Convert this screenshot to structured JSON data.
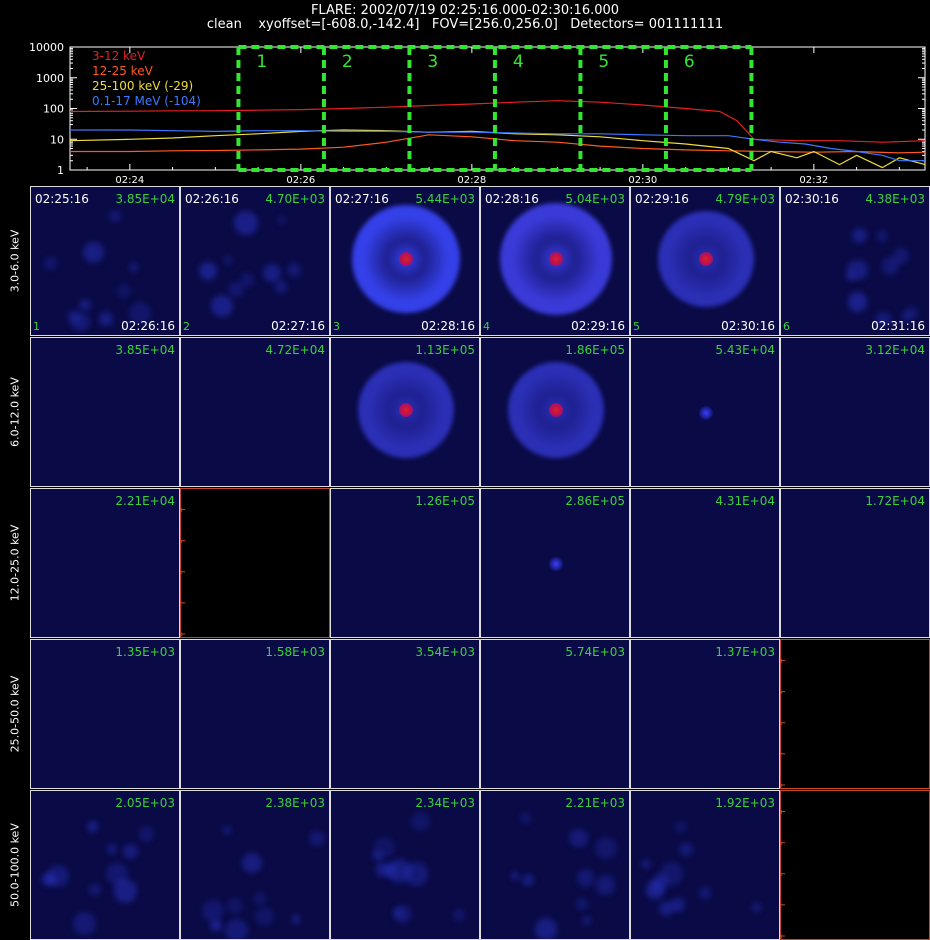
{
  "header": {
    "line1": "FLARE: 2002/07/19 02:25:16.000-02:30:16.000",
    "line2": "clean    xyoffset=[-608.0,-142.4]   FOV=[256.0,256.0]   Detectors= 001111111"
  },
  "chart_data": {
    "type": "line",
    "yscale": "log",
    "ylim": [
      1,
      10000
    ],
    "ytick_labels": [
      "1",
      "10",
      "100",
      "1000",
      "10000"
    ],
    "x_unit": "minutes after 02:00",
    "xlim": [
      23.3,
      33.3
    ],
    "xtick_labels": [
      "02:24",
      "02:26",
      "02:28",
      "02:30",
      "02:32"
    ],
    "xtick_values": [
      24,
      26,
      28,
      30,
      32
    ],
    "legend": [
      {
        "label": "3-12 keV",
        "color": "#e62020"
      },
      {
        "label": "12-25 keV",
        "color": "#ff5a1e"
      },
      {
        "label": "25-100 keV (-29)",
        "color": "#f0dc3c"
      },
      {
        "label": "0.1-17 MeV (-104)",
        "color": "#3c78ff"
      }
    ],
    "intervals": [
      {
        "label": "1",
        "start": 25.27,
        "end": 26.27
      },
      {
        "label": "2",
        "start": 26.27,
        "end": 27.27
      },
      {
        "label": "3",
        "start": 27.27,
        "end": 28.27
      },
      {
        "label": "4",
        "start": 28.27,
        "end": 29.27
      },
      {
        "label": "5",
        "start": 29.27,
        "end": 30.27
      },
      {
        "label": "6",
        "start": 30.27,
        "end": 31.27
      }
    ],
    "series": [
      {
        "name": "3-12 keV",
        "color": "#e62020",
        "x": [
          23.3,
          24.0,
          24.5,
          25.0,
          25.5,
          26.0,
          26.5,
          27.0,
          27.5,
          28.0,
          28.5,
          29.0,
          29.5,
          30.0,
          30.5,
          30.9,
          31.1,
          31.3,
          31.8,
          32.3,
          32.8,
          33.3
        ],
        "y": [
          80,
          82,
          84,
          85,
          88,
          92,
          100,
          110,
          125,
          140,
          160,
          180,
          160,
          130,
          100,
          80,
          40,
          10,
          9,
          9,
          8,
          9
        ]
      },
      {
        "name": "12-25 keV",
        "color": "#ff5a1e",
        "x": [
          23.3,
          24.0,
          24.5,
          25.0,
          25.5,
          26.0,
          26.5,
          27.0,
          27.5,
          28.0,
          28.5,
          29.0,
          29.5,
          30.0,
          30.5,
          31.0,
          31.5,
          32.0,
          32.5,
          33.0,
          33.3
        ],
        "y": [
          4,
          4,
          4.2,
          4.3,
          4.5,
          4.8,
          5.5,
          8,
          14,
          12,
          9,
          8,
          6,
          5,
          4.5,
          4.2,
          4,
          3.8,
          4,
          3.6,
          3.8
        ]
      },
      {
        "name": "25-100 keV (-29)",
        "color": "#f0dc3c",
        "x": [
          23.3,
          24.0,
          24.5,
          25.0,
          25.5,
          26.0,
          26.5,
          27.0,
          27.5,
          28.0,
          28.5,
          29.0,
          29.5,
          30.0,
          30.5,
          31.0,
          31.3,
          31.5,
          31.8,
          32.0,
          32.3,
          32.5,
          32.8,
          33.0,
          33.3
        ],
        "y": [
          9,
          10,
          11,
          13,
          15,
          18,
          20,
          19,
          17,
          18,
          15,
          14,
          12,
          9,
          7,
          5,
          2,
          4,
          2.5,
          4,
          1.5,
          3,
          1.2,
          2.5,
          1.5
        ]
      },
      {
        "name": "0.1-17 MeV (-104)",
        "color": "#3c78ff",
        "x": [
          23.3,
          24.0,
          24.5,
          25.0,
          25.5,
          26.0,
          26.5,
          27.0,
          27.5,
          28.0,
          28.5,
          29.0,
          29.5,
          30.0,
          30.5,
          31.0,
          31.3,
          31.6,
          31.9,
          32.2,
          32.5,
          32.8,
          33.0,
          33.3
        ],
        "y": [
          20,
          20,
          19,
          18,
          19,
          19,
          18,
          18,
          17,
          17,
          16,
          15,
          15,
          14,
          13,
          13,
          10,
          8,
          7,
          5,
          4,
          3,
          2,
          2
        ]
      }
    ]
  },
  "images": {
    "row_labels": [
      "3.0-6.0 keV",
      "6.0-12.0 keV",
      "12.0-25.0 keV",
      "25.0-50.0 keV",
      "50.0-100.0 keV"
    ],
    "start_times": [
      "02:25:16",
      "02:26:16",
      "02:27:16",
      "02:28:16",
      "02:29:16",
      "02:30:16"
    ],
    "end_times": [
      "02:26:16",
      "02:27:16",
      "02:28:16",
      "02:29:16",
      "02:30:16",
      "02:31:16"
    ],
    "interval_numbers": [
      "1",
      "2",
      "3",
      "4",
      "5",
      "6"
    ],
    "maxima": [
      [
        "3.85E+04",
        "4.70E+03",
        "5.44E+03",
        "5.04E+03",
        "4.79E+03",
        "4.38E+03"
      ],
      [
        "3.85E+04",
        "4.72E+04",
        "1.13E+05",
        "1.86E+05",
        "5.43E+04",
        "3.12E+04"
      ],
      [
        "2.21E+04",
        "",
        "1.26E+05",
        "2.86E+05",
        "4.31E+04",
        "1.72E+04"
      ],
      [
        "1.35E+03",
        "1.58E+03",
        "3.54E+03",
        "5.74E+03",
        "1.37E+03",
        ""
      ],
      [
        "2.05E+03",
        "2.38E+03",
        "2.34E+03",
        "2.21E+03",
        "1.92E+03",
        ""
      ]
    ],
    "empty_axis_ticks": [
      "0",
      "2",
      "4",
      "6",
      "8"
    ],
    "colors": {
      "background": "#0a0a46",
      "accent_text": "#3cd13c",
      "empty_axis": "#c94a2a"
    }
  }
}
